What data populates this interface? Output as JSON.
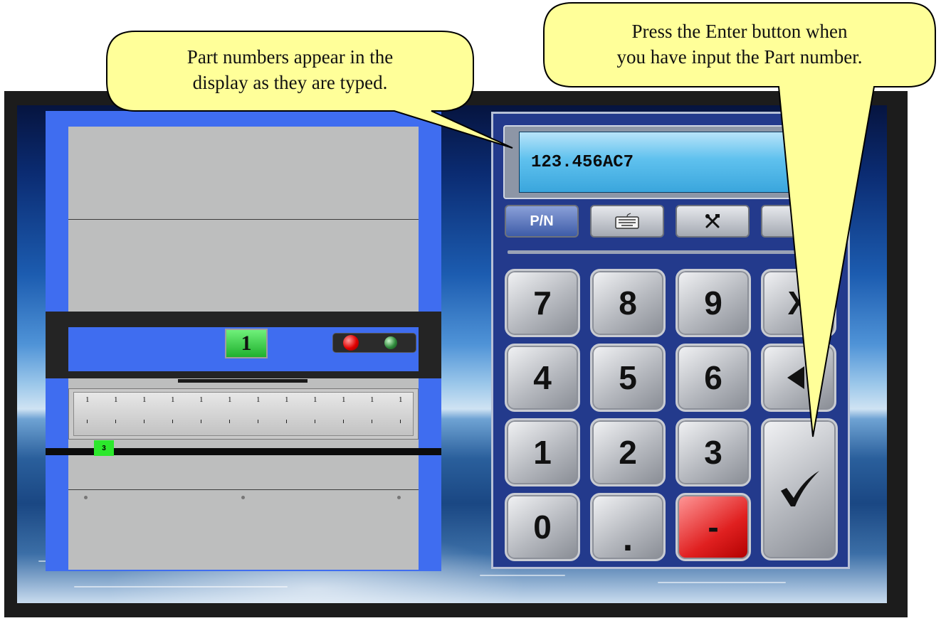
{
  "display": {
    "value": "123.456AC7"
  },
  "mode_buttons": {
    "pn_label": "P/N",
    "keyboard_icon": "keyboard-icon",
    "tools_icon": "tools-icon"
  },
  "keypad": {
    "keys": [
      "7",
      "8",
      "9",
      "4",
      "5",
      "6",
      "1",
      "2",
      "3",
      "0",
      ".",
      "-"
    ],
    "clear_label": "X",
    "backspace_icon": "backspace-icon",
    "enter_icon": "checkmark-icon"
  },
  "machine": {
    "station_number": "1",
    "tray_tag": "3",
    "tick_labels": [
      "1",
      "1",
      "1",
      "1",
      "1",
      "1",
      "1",
      "1",
      "1",
      "1",
      "1",
      "1"
    ]
  },
  "callouts": {
    "left": {
      "line1": "Part numbers appear in the",
      "line2": "display as they are typed."
    },
    "right": {
      "line1": "Press the Enter button when",
      "line2": "you have input the Part number."
    }
  },
  "colors": {
    "machine_blue": "#3f6df0",
    "keypad_blue": "#233a8c",
    "callout_fill": "#ffff99",
    "station_green": "#2ce82c",
    "minus_red": "#e02020"
  }
}
